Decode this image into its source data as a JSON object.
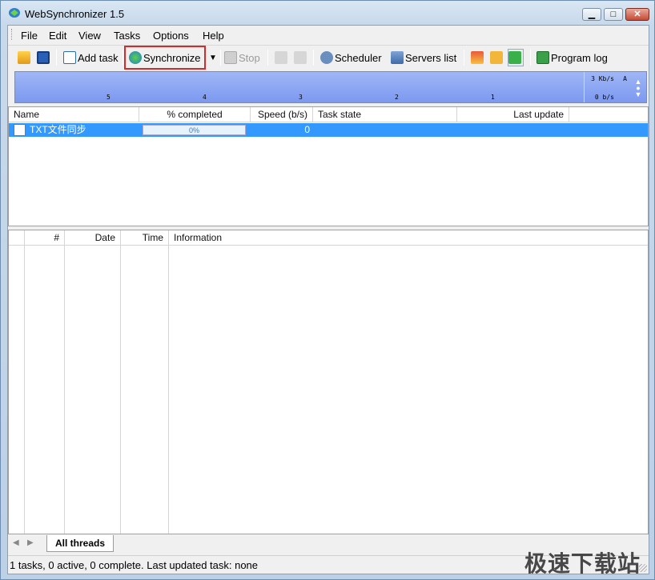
{
  "window": {
    "title": "WebSynchronizer 1.5",
    "min": "▁",
    "max": "□",
    "close": "✕"
  },
  "menu": [
    "File",
    "Edit",
    "View",
    "Tasks",
    "Options",
    "Help"
  ],
  "toolbar": {
    "add_task": "Add task",
    "synchronize": "Synchronize",
    "stop": "Stop",
    "scheduler": "Scheduler",
    "servers_list": "Servers list",
    "program_log": "Program log"
  },
  "graph": {
    "ticks": [
      "5",
      "4",
      "3",
      "2",
      "1"
    ],
    "top_scale": "3 Kb/s",
    "bottom_scale": "0 b/s",
    "auto": "A"
  },
  "tasks": {
    "columns": [
      "Name",
      "% completed",
      "Speed (b/s)",
      "Task state",
      "Last update"
    ],
    "rows": [
      {
        "name": "TXT文件同步",
        "completed": "0%",
        "speed": "0",
        "state": "",
        "last_update": ""
      }
    ]
  },
  "log": {
    "columns": [
      "#",
      "Date",
      "Time",
      "Information"
    ]
  },
  "tabs": {
    "active": "All threads"
  },
  "status": {
    "text": "1 tasks, 0 active, 0 complete. Last updated task: none",
    "watermark": "极速下载站"
  },
  "colors": {
    "selection": "#3399ff",
    "graph": "#8aa5f3",
    "highlight": "#d42b2b"
  }
}
